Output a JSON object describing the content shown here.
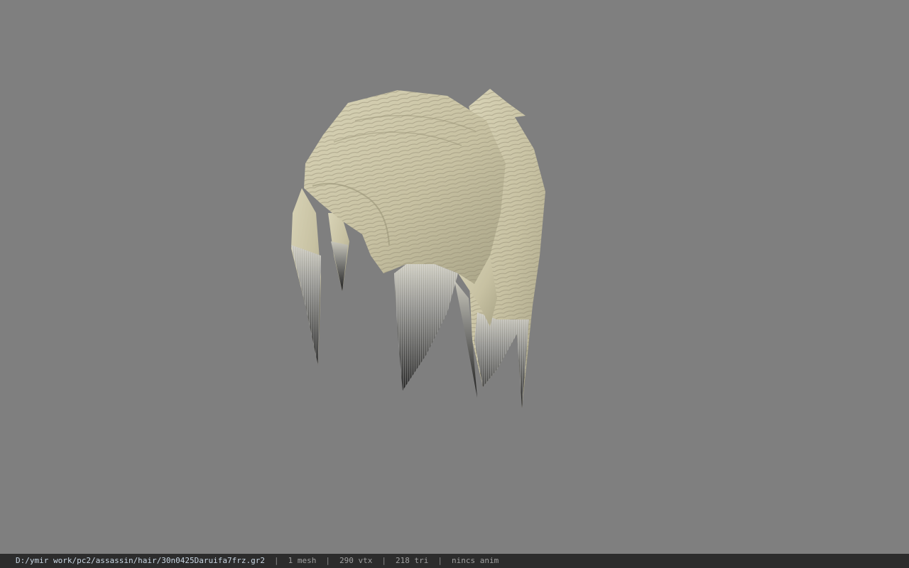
{
  "viewport": {
    "background_color": "#7f7f7f",
    "model": "hair-mesh",
    "hair_color": "#cfc9aa",
    "tip_color": "#2e2e2e"
  },
  "statusbar": {
    "file_path": "D:/ymir work/pc2/assassin/hair/30n0425Daruifa7frz.gr2",
    "separator": "|",
    "mesh_count": "1 mesh",
    "vertex_count": "290 vtx",
    "triangle_count": "218 tri",
    "anim_status": "nincs anim"
  }
}
